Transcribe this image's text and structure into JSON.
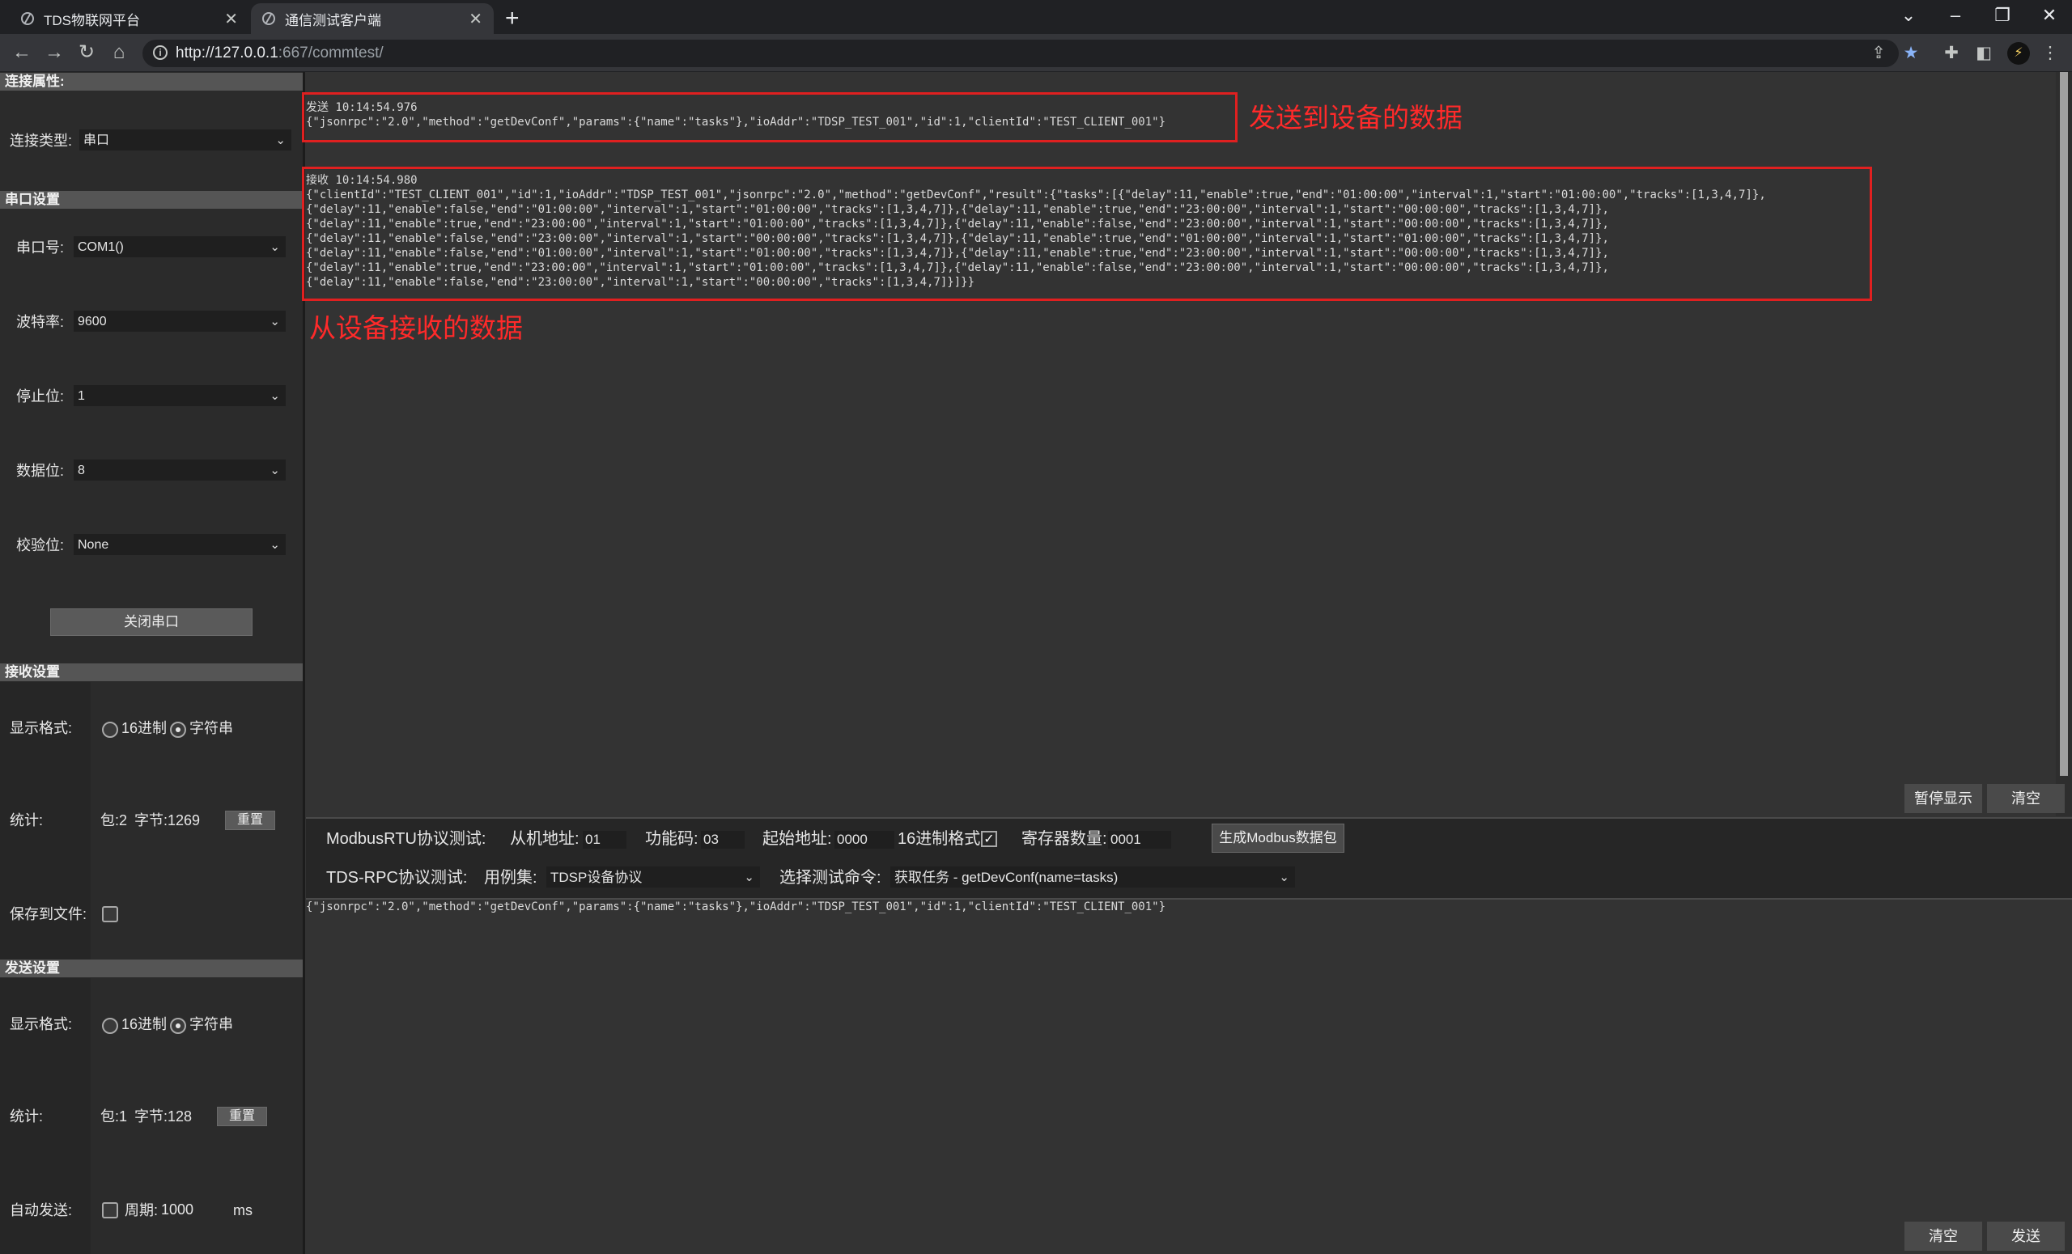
{
  "browser": {
    "tabs": [
      {
        "title": "TDS物联网平台",
        "active": false
      },
      {
        "title": "通信测试客户端",
        "active": true
      }
    ],
    "url_host": "http://127.0.0.1",
    "url_rest": ":667/commtest/"
  },
  "sidebar": {
    "connection_header": "连接属性:",
    "conn_type_label": "连接类型:",
    "conn_type_value": "串口",
    "serial_header": "串口设置",
    "port_label": "串口号:",
    "port_value": "COM1()",
    "baud_label": "波特率:",
    "baud_value": "9600",
    "stopbits_label": "停止位:",
    "stopbits_value": "1",
    "databits_label": "数据位:",
    "databits_value": "8",
    "parity_label": "校验位:",
    "parity_value": "None",
    "close_port_button": "关闭串口",
    "recv_header": "接收设置",
    "recv_format_label": "显示格式:",
    "recv_hex_label": "16进制",
    "recv_str_label": "字符串",
    "recv_stats_label": "统计:",
    "recv_packets": "包:2",
    "recv_bytes": "字节:1269",
    "recv_reset_button": "重置",
    "save_file_label": "保存到文件:",
    "send_header": "发送设置",
    "send_format_label": "显示格式:",
    "send_hex_label": "16进制",
    "send_str_label": "字符串",
    "send_stats_label": "统计:",
    "send_packets": "包:1",
    "send_bytes": "字节:128",
    "send_reset_button": "重置",
    "auto_send_label": "自动发送:",
    "period_label": "周期:",
    "period_value": "1000",
    "period_unit": "ms"
  },
  "log": {
    "sent_header": "发送 10:14:54.976",
    "sent_body": "{\"jsonrpc\":\"2.0\",\"method\":\"getDevConf\",\"params\":{\"name\":\"tasks\"},\"ioAddr\":\"TDSP_TEST_001\",\"id\":1,\"clientId\":\"TEST_CLIENT_001\"}",
    "recv_header": "接收 10:14:54.980",
    "recv_lines": [
      "{\"clientId\":\"TEST_CLIENT_001\",\"id\":1,\"ioAddr\":\"TDSP_TEST_001\",\"jsonrpc\":\"2.0\",\"method\":\"getDevConf\",\"result\":{\"tasks\":[{\"delay\":11,\"enable\":true,\"end\":\"01:00:00\",\"interval\":1,\"start\":\"01:00:00\",\"tracks\":[1,3,4,7]},",
      "{\"delay\":11,\"enable\":false,\"end\":\"01:00:00\",\"interval\":1,\"start\":\"01:00:00\",\"tracks\":[1,3,4,7]},{\"delay\":11,\"enable\":true,\"end\":\"23:00:00\",\"interval\":1,\"start\":\"00:00:00\",\"tracks\":[1,3,4,7]},",
      "{\"delay\":11,\"enable\":true,\"end\":\"23:00:00\",\"interval\":1,\"start\":\"01:00:00\",\"tracks\":[1,3,4,7]},{\"delay\":11,\"enable\":false,\"end\":\"23:00:00\",\"interval\":1,\"start\":\"00:00:00\",\"tracks\":[1,3,4,7]},",
      "{\"delay\":11,\"enable\":false,\"end\":\"23:00:00\",\"interval\":1,\"start\":\"00:00:00\",\"tracks\":[1,3,4,7]},{\"delay\":11,\"enable\":true,\"end\":\"01:00:00\",\"interval\":1,\"start\":\"01:00:00\",\"tracks\":[1,3,4,7]},",
      "{\"delay\":11,\"enable\":false,\"end\":\"01:00:00\",\"interval\":1,\"start\":\"01:00:00\",\"tracks\":[1,3,4,7]},{\"delay\":11,\"enable\":true,\"end\":\"23:00:00\",\"interval\":1,\"start\":\"00:00:00\",\"tracks\":[1,3,4,7]},",
      "{\"delay\":11,\"enable\":true,\"end\":\"23:00:00\",\"interval\":1,\"start\":\"01:00:00\",\"tracks\":[1,3,4,7]},{\"delay\":11,\"enable\":false,\"end\":\"23:00:00\",\"interval\":1,\"start\":\"00:00:00\",\"tracks\":[1,3,4,7]},",
      "{\"delay\":11,\"enable\":false,\"end\":\"23:00:00\",\"interval\":1,\"start\":\"00:00:00\",\"tracks\":[1,3,4,7]}]}}"
    ],
    "annotation_sent": "发送到设备的数据",
    "annotation_recv": "从设备接收的数据",
    "pause_button": "暂停显示",
    "clear_button": "清空"
  },
  "modbus": {
    "title": "ModbusRTU协议测试:",
    "slave_label": "从机地址:",
    "slave_value": "01",
    "func_label": "功能码:",
    "func_value": "03",
    "start_label": "起始地址:",
    "start_value": "0000",
    "hex_label": "16进制格式",
    "hex_check": "✓",
    "reg_label": "寄存器数量:",
    "reg_value": "0001",
    "gen_button": "生成Modbus数据包"
  },
  "tdsrpc": {
    "title": "TDS-RPC协议测试:",
    "case_label": "用例集:",
    "case_value": "TDSP设备协议",
    "cmd_label": "选择测试命令:",
    "cmd_value": "获取任务 - getDevConf(name=tasks)"
  },
  "send": {
    "text": "{\"jsonrpc\":\"2.0\",\"method\":\"getDevConf\",\"params\":{\"name\":\"tasks\"},\"ioAddr\":\"TDSP_TEST_001\",\"id\":1,\"clientId\":\"TEST_CLIENT_001\"}",
    "clear_button": "清空",
    "send_button": "发送"
  },
  "colors": {
    "annotation_red": "#e02020",
    "background": "#333333",
    "panel": "#2b2b2b"
  }
}
